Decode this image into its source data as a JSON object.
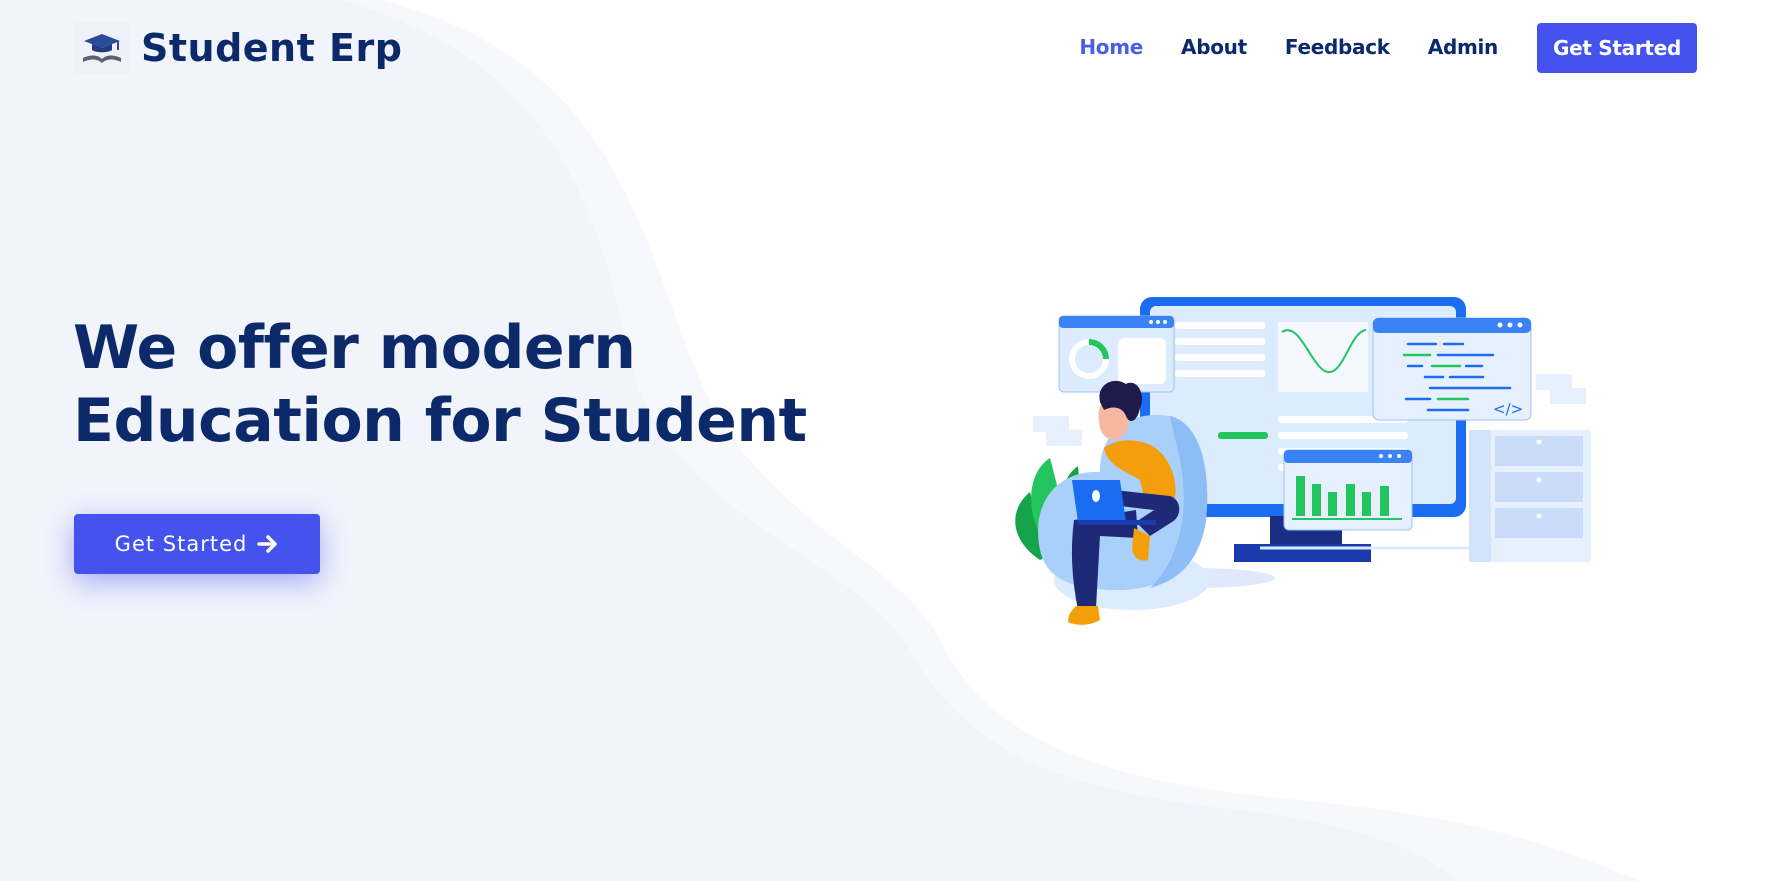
{
  "brand": {
    "name": "Student Erp",
    "logo_icon": "graduation-cap-book-icon"
  },
  "nav": {
    "items": [
      {
        "label": "Home",
        "active": true
      },
      {
        "label": "About",
        "active": false
      },
      {
        "label": "Feedback",
        "active": false
      },
      {
        "label": "Admin",
        "active": false
      }
    ],
    "cta_label": "Get Started"
  },
  "hero": {
    "title": "We offer modern Education for Student",
    "cta_label": "Get Started",
    "cta_icon": "arrow-right-icon"
  },
  "illustration": {
    "code_label": "</>"
  },
  "colors": {
    "primary": "#4452ee",
    "heading": "#0c2a69",
    "nav_active": "#4b5fe0",
    "background_wave": "#f1f4fb"
  }
}
